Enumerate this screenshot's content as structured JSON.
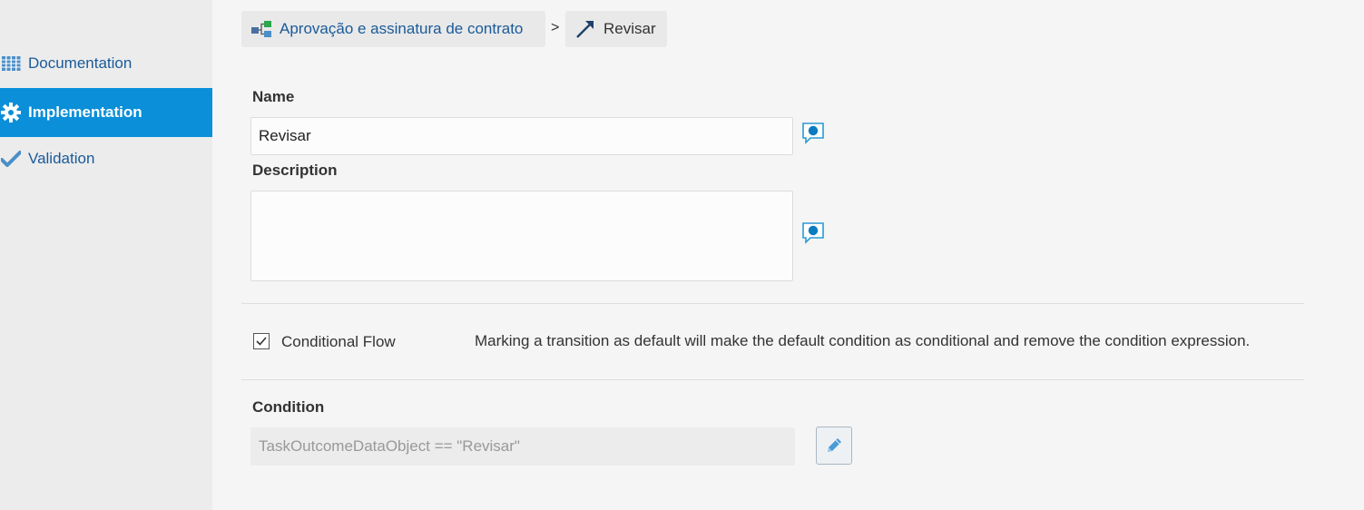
{
  "sidebar": {
    "items": [
      {
        "label": "Documentation",
        "icon": "documentation-icon"
      },
      {
        "label": "Implementation",
        "icon": "gear-icon",
        "active": true
      },
      {
        "label": "Validation",
        "icon": "checkmark-icon"
      }
    ]
  },
  "breadcrumb": {
    "process": "Aprovação e assinatura de contrato",
    "separator": ">",
    "current": "Revisar"
  },
  "form": {
    "name_label": "Name",
    "name_value": "Revisar",
    "description_label": "Description",
    "description_value": "",
    "conditional_flow_label": "Conditional Flow",
    "conditional_flow_checked": true,
    "conditional_flow_hint": "Marking a transition as default will make the default condition as conditional and remove the condition expression.",
    "condition_label": "Condition",
    "condition_value": "TaskOutcomeDataObject == \"Revisar\""
  },
  "colors": {
    "accent": "#0a8fd8",
    "link": "#1a5a9a"
  }
}
